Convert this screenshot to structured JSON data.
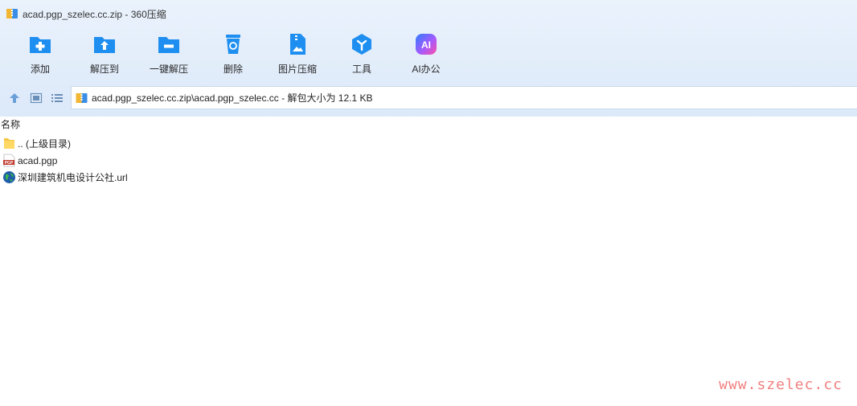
{
  "window": {
    "title": "acad.pgp_szelec.cc.zip - 360压缩"
  },
  "toolbar": {
    "buttons": [
      {
        "label": "添加",
        "icon": "add-folder-icon"
      },
      {
        "label": "解压到",
        "icon": "extract-to-icon"
      },
      {
        "label": "一键解压",
        "icon": "one-click-extract-icon"
      },
      {
        "label": "删除",
        "icon": "delete-icon"
      },
      {
        "label": "图片压缩",
        "icon": "image-compress-icon"
      },
      {
        "label": "工具",
        "icon": "tools-icon"
      },
      {
        "label": "AI办公",
        "icon": "ai-office-icon"
      }
    ]
  },
  "address": {
    "path": "acad.pgp_szelec.cc.zip\\acad.pgp_szelec.cc - 解包大小为 12.1 KB"
  },
  "list": {
    "column_name": "名称",
    "items": [
      {
        "name": ".. (上级目录)",
        "icon": "folder-up-icon"
      },
      {
        "name": "acad.pgp",
        "icon": "pgp-file-icon"
      },
      {
        "name": "深圳建筑机电设计公社.url",
        "icon": "url-globe-icon"
      }
    ]
  },
  "watermark": "www.szelec.cc",
  "colors": {
    "toolbar_blue": "#1e8ff0",
    "watermark": "#f06a6a",
    "header_bg": "#dce9f9"
  }
}
